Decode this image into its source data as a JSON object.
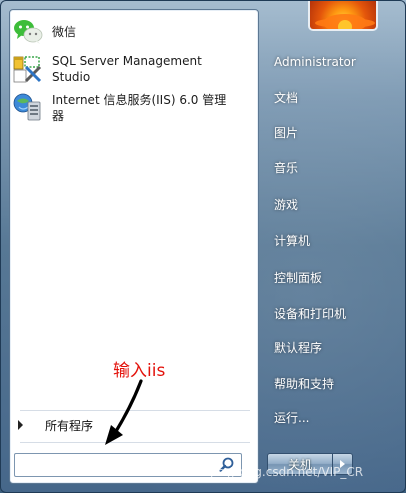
{
  "programs": [
    {
      "label": "微信",
      "icon": "wechat-icon"
    },
    {
      "label_line1": "SQL Server Management",
      "label_line2": "Studio",
      "icon": "sql-server-management-studio-icon"
    },
    {
      "label_line1": "Internet 信息服务(IIS) 6.0 管理",
      "label_line2": "器",
      "icon": "iis-manager-icon"
    }
  ],
  "all_programs": {
    "label": "所有程序"
  },
  "search": {
    "value": "",
    "placeholder": ""
  },
  "annotation": {
    "text": "输入iis",
    "color": "#e3120b"
  },
  "right_menu": [
    {
      "label": "Administrator"
    },
    {
      "label": "文档"
    },
    {
      "label": "图片"
    },
    {
      "label": "音乐"
    },
    {
      "label": "游戏"
    },
    {
      "label": "计算机"
    },
    {
      "label": "控制面板"
    },
    {
      "label": "设备和打印机"
    },
    {
      "label": "默认程序"
    },
    {
      "label": "帮助和支持"
    },
    {
      "label": "运行..."
    }
  ],
  "shutdown": {
    "label": "关机"
  },
  "watermark": "https://blog.csdn.net/VIP_CR"
}
